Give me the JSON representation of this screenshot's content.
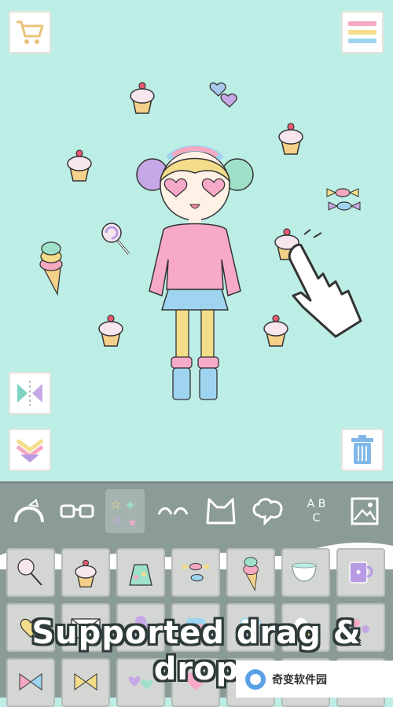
{
  "top_bar": {
    "cart_icon": "shopping-cart-icon",
    "menu_icon": "menu-icon"
  },
  "side_buttons": {
    "flip_icon": "flip-icon",
    "layer_icon": "layer-down-icon",
    "trash_icon": "trash-icon"
  },
  "toolbar": {
    "categories": [
      "headband",
      "glasses",
      "stickers",
      "eyebrows",
      "ears",
      "speech-bubble",
      "text",
      "background"
    ],
    "text_tool_label": "A B C"
  },
  "colors": {
    "background": "#bdeee6",
    "toolbar": "#8b9b98",
    "cell": "#d3d6d3",
    "accent_pink": "#f7a9c8"
  },
  "caption": "Supported drag & drop",
  "watermark": "奇变软件园"
}
